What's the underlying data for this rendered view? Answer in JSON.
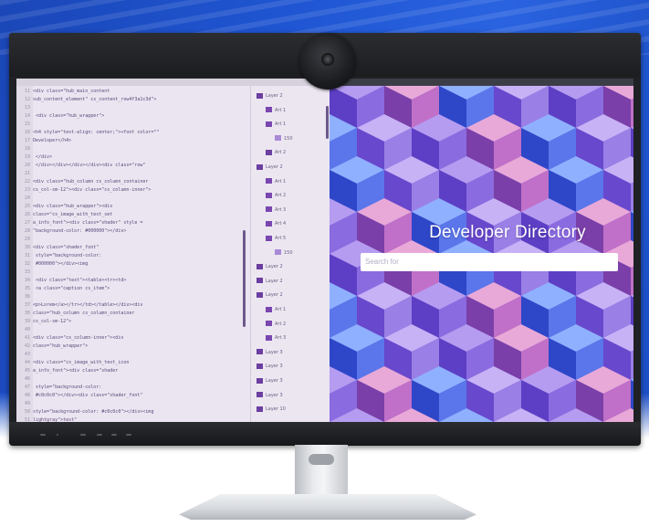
{
  "preview": {
    "title": "Developer Directory",
    "search_placeholder": "Search for"
  },
  "layers_panel": {
    "items": [
      {
        "label": "Layer 2",
        "color": "#6b3fa0"
      },
      {
        "label": "Art 1",
        "color": "#7a46b0"
      },
      {
        "label": "Art 1",
        "color": "#7a46b0"
      },
      {
        "label": "150",
        "color": "#a98ad6"
      },
      {
        "label": "Art 2",
        "color": "#6b3fa0"
      },
      {
        "label": "Layer 2",
        "color": "#6b3fa0"
      },
      {
        "label": "Art 1",
        "color": "#7a46b0"
      },
      {
        "label": "Art 2",
        "color": "#7a46b0"
      },
      {
        "label": "Art 3",
        "color": "#7a46b0"
      },
      {
        "label": "Art 4",
        "color": "#7a46b0"
      },
      {
        "label": "Art 5",
        "color": "#7a46b0"
      },
      {
        "label": "150",
        "color": "#a98ad6"
      },
      {
        "label": "Layer 2",
        "color": "#6b3fa0"
      },
      {
        "label": "Layer 2",
        "color": "#6b3fa0"
      },
      {
        "label": "Layer 2",
        "color": "#6b3fa0"
      },
      {
        "label": "Art 1",
        "color": "#7a46b0"
      },
      {
        "label": "Art 2",
        "color": "#7a46b0"
      },
      {
        "label": "Art 3",
        "color": "#7a46b0"
      },
      {
        "label": "Layer 3",
        "color": "#6b3fa0"
      },
      {
        "label": "Layer 3",
        "color": "#6b3fa0"
      },
      {
        "label": "Layer 3",
        "color": "#6b3fa0"
      },
      {
        "label": "Layer 3",
        "color": "#6b3fa0"
      },
      {
        "label": "Layer 10",
        "color": "#6b3fa0"
      }
    ]
  },
  "editor": {
    "lines": [
      {
        "n": "11",
        "code": "<div class=\"hub_main_content"
      },
      {
        "n": "12",
        "code": "sub_content_element\" cs_content_row4f3a1c3d\">"
      },
      {
        "n": "13",
        "code": ""
      },
      {
        "n": "14",
        "code": "    <div class=\"hub_wrapper\">"
      },
      {
        "n": "15",
        "code": ""
      },
      {
        "n": "16",
        "code": "<h4 style=\"text-align: center;\"><font color=\"\""
      },
      {
        "n": "17",
        "code": "Developer</h4>"
      },
      {
        "n": "18",
        "code": ""
      },
      {
        "n": "19",
        "code": "    </div>"
      },
      {
        "n": "20",
        "code": "  </div></div></div></div><div class=\"row\""
      },
      {
        "n": "21",
        "code": ""
      },
      {
        "n": "22",
        "code": "<div class=\"hub_column cs_column_container"
      },
      {
        "n": "23",
        "code": "cs_col-sm-12\"><div class=\"cs_column-inner\">"
      },
      {
        "n": "24",
        "code": ""
      },
      {
        "n": "25",
        "code": "<div class=\"hub_wrapper\"><div"
      },
      {
        "n": "26",
        "code": "class=\"cs_image_with_text_set"
      },
      {
        "n": "27",
        "code": "a_info_font\"><div class=\"shader\" style ="
      },
      {
        "n": "28",
        "code": "\"background-color: #000000\"></div>"
      },
      {
        "n": "29",
        "code": ""
      },
      {
        "n": "30",
        "code": "<div class=\"shader_font\""
      },
      {
        "n": "31",
        "code": "  style=\"background-color:"
      },
      {
        "n": "32",
        "code": "  #000000\"></div><img"
      },
      {
        "n": "33",
        "code": ""
      },
      {
        "n": "34",
        "code": "  <div class=\"text\"><table><tr><td>"
      },
      {
        "n": "35",
        "code": "    <a class=\"caption cs_item\">"
      },
      {
        "n": "36",
        "code": ""
      },
      {
        "n": "37",
        "code": "<p>Lorem</a></tr></td></table></div><div"
      },
      {
        "n": "38",
        "code": "class=\"hub_column cs_column_container"
      },
      {
        "n": "39",
        "code": "cs_col-sm-12\">"
      },
      {
        "n": "40",
        "code": ""
      },
      {
        "n": "41",
        "code": "<div  class=\"cs_column-inner\"><div"
      },
      {
        "n": "42",
        "code": "class=\"hub_wrapper\">"
      },
      {
        "n": "43",
        "code": ""
      },
      {
        "n": "44",
        "code": "<div class=\"cs_image_with_text_icon"
      },
      {
        "n": "45",
        "code": "a_info_font\"><div class=\"shader"
      },
      {
        "n": "46",
        "code": ""
      },
      {
        "n": "47",
        "code": "    style=\"background-color:"
      },
      {
        "n": "48",
        "code": "    #c0c0c0\"></div><div class=\"shader_font\""
      },
      {
        "n": "49",
        "code": ""
      },
      {
        "n": "50",
        "code": "style=\"background-color: #c0c0c0\"></div><img"
      },
      {
        "n": "51",
        "code": "lightgray\">text\""
      }
    ]
  },
  "colors": {
    "backdrop": "#1f55d2",
    "editor_bg": "#ebe5f1",
    "code_text": "#5a4a7a",
    "preview_bg": "#7a68e8"
  }
}
